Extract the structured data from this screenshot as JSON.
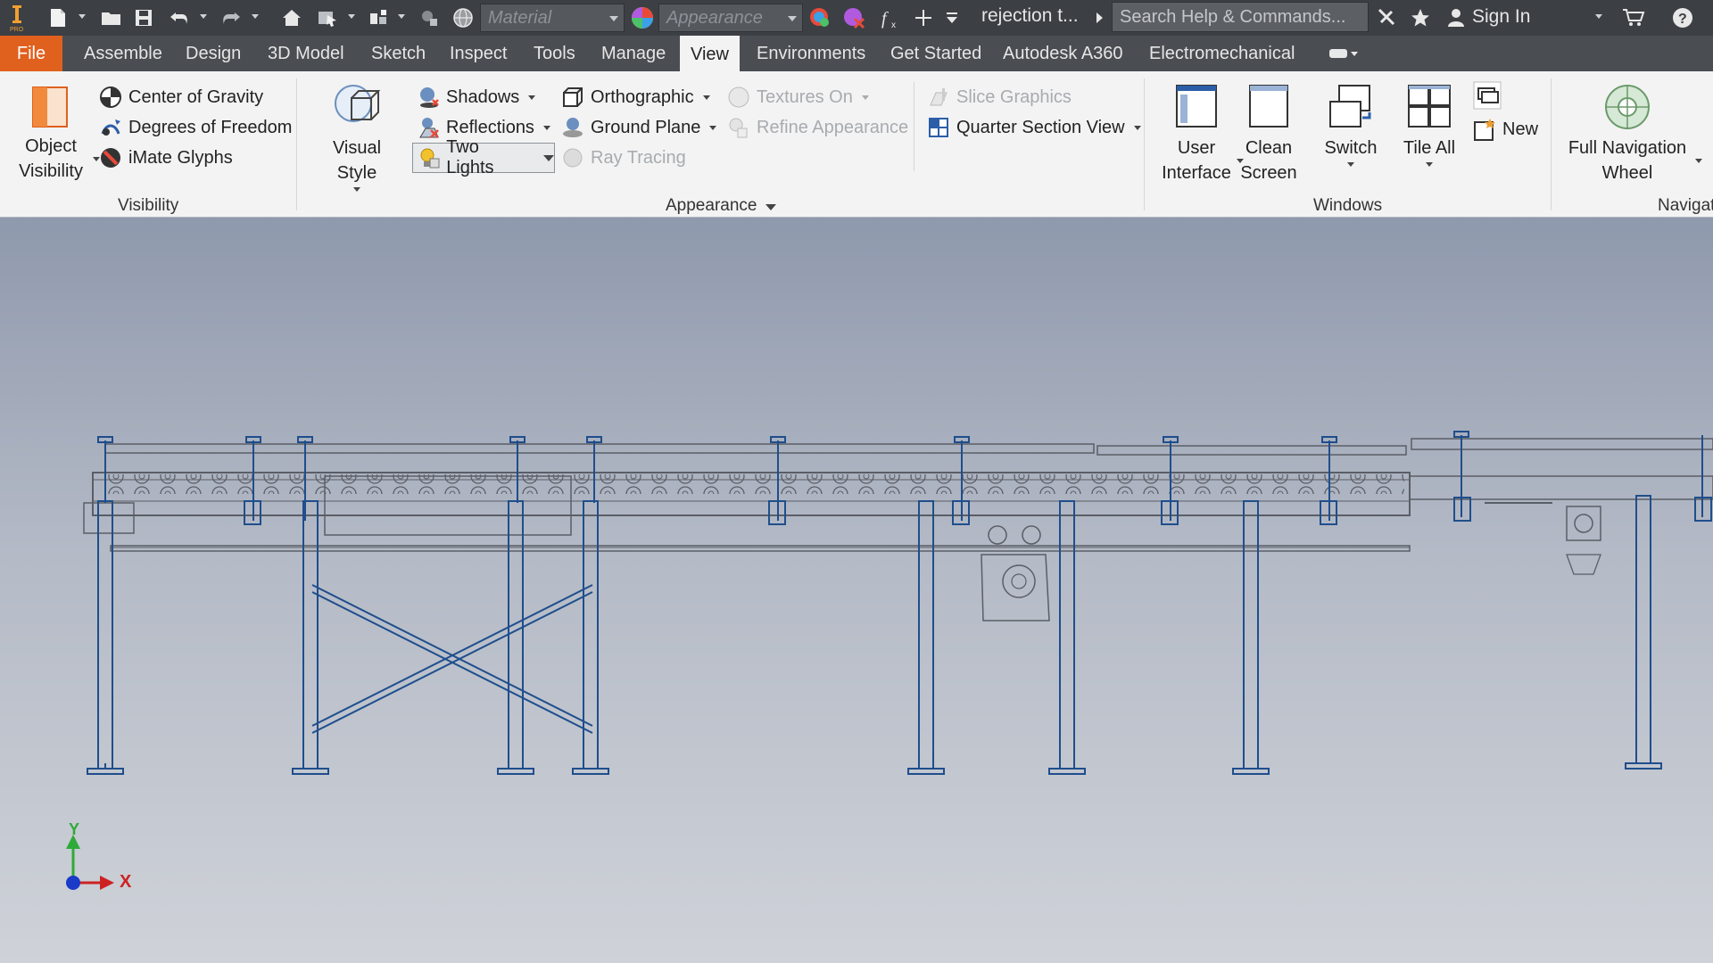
{
  "quick_access": {
    "material_placeholder": "Material",
    "appearance_placeholder": "Appearance",
    "document_title": "rejection t...",
    "search_placeholder": "Search Help & Commands...",
    "sign_in": "Sign In"
  },
  "tabs": [
    {
      "label": "File"
    },
    {
      "label": "Assemble"
    },
    {
      "label": "Design"
    },
    {
      "label": "3D Model"
    },
    {
      "label": "Sketch"
    },
    {
      "label": "Inspect"
    },
    {
      "label": "Tools"
    },
    {
      "label": "Manage"
    },
    {
      "label": "View"
    },
    {
      "label": "Environments"
    },
    {
      "label": "Get Started"
    },
    {
      "label": "Autodesk A360"
    },
    {
      "label": "Electromechanical"
    }
  ],
  "active_tab": "View",
  "ribbon": {
    "visibility": {
      "title": "Visibility",
      "object_visibility_1": "Object",
      "object_visibility_2": "Visibility",
      "center_of_gravity": "Center of Gravity",
      "degrees_of_freedom": "Degrees of Freedom",
      "imate_glyphs": "iMate Glyphs"
    },
    "appearance": {
      "title": "Appearance",
      "visual_style_1": "Visual Style",
      "shadows": "Shadows",
      "reflections": "Reflections",
      "two_lights": "Two Lights",
      "orthographic": "Orthographic",
      "ground_plane": "Ground Plane",
      "ray_tracing": "Ray Tracing",
      "textures_on": "Textures On",
      "refine_appearance": "Refine Appearance",
      "slice_graphics": "Slice Graphics",
      "quarter_section_view": "Quarter Section View"
    },
    "windows": {
      "title": "Windows",
      "user_interface_1": "User",
      "user_interface_2": "Interface",
      "clean_screen_1": "Clean",
      "clean_screen_2": "Screen",
      "switch": "Switch",
      "tile_all": "Tile All",
      "new": "New"
    },
    "navigate": {
      "title": "Navigate",
      "full_nav_wheel_1": "Full Navigation",
      "full_nav_wheel_2": "Wheel"
    }
  },
  "triad": {
    "y_label": "Y",
    "x_label": "X"
  },
  "colors": {
    "accent_file_tab": "#e0601e",
    "model_blue": "#1f4e8c",
    "model_gray": "#5a5e66"
  }
}
